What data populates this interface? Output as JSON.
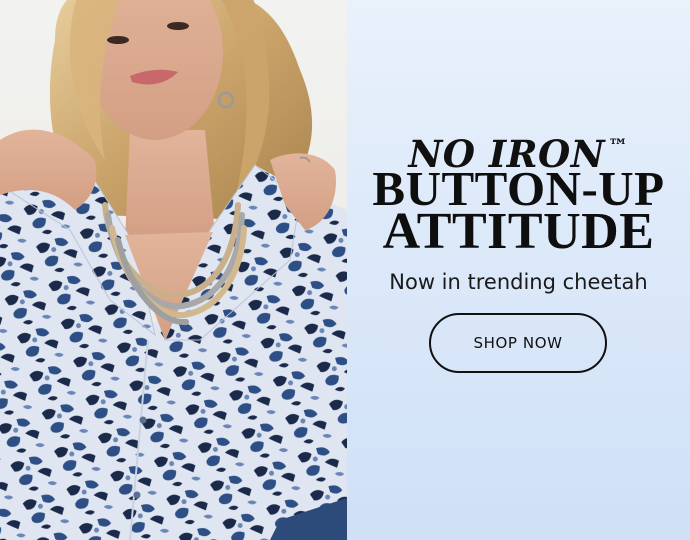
{
  "promo": {
    "headline_top": "NO IRON",
    "trademark": "™",
    "headline_line1": "BUTTON-UP",
    "headline_line2": "ATTITUDE",
    "subhead": "Now in trending cheetah",
    "cta_label": "SHOP NOW"
  },
  "colors": {
    "promo_background_top": "#e9f1fb",
    "promo_background_bottom": "#cfe0f7",
    "text": "#111111",
    "print_blue": "#2d4f86",
    "print_navy": "#1b2a4a",
    "print_light": "#dfe6f1"
  }
}
